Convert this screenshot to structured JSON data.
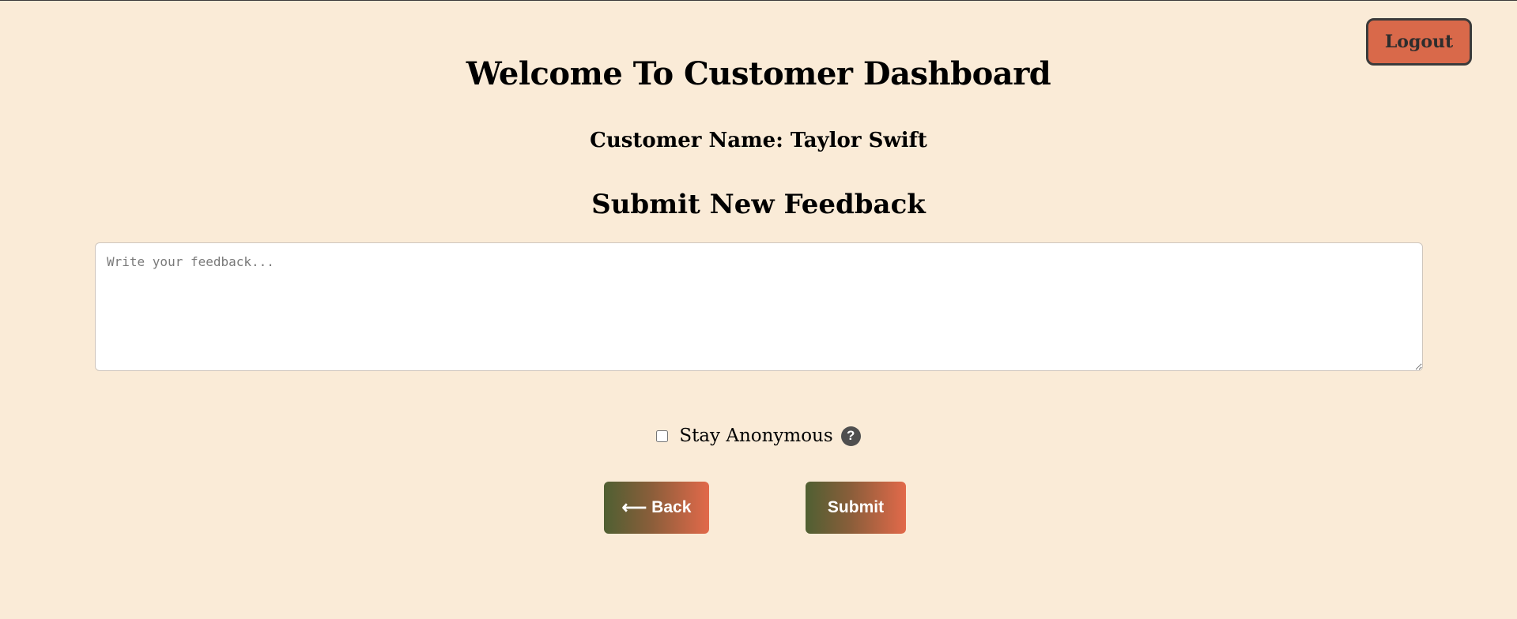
{
  "header": {
    "logout_label": "Logout"
  },
  "main": {
    "title": "Welcome To Customer Dashboard",
    "customer_name": "Customer Name: Taylor Swift",
    "section_title": "Submit New Feedback",
    "feedback": {
      "value": "",
      "placeholder": "Write your feedback..."
    },
    "anonymous": {
      "label": "Stay Anonymous",
      "checked": false,
      "help_icon": "?"
    },
    "buttons": {
      "back_arrow": "⟵",
      "back_label": "Back",
      "submit_label": "Submit"
    }
  },
  "colors": {
    "background": "#faebd7",
    "logout_button": "#d9694a",
    "button_gradient_start": "#4f5f32",
    "button_gradient_end": "#e2694a",
    "help_icon": "#4f4f4f"
  }
}
